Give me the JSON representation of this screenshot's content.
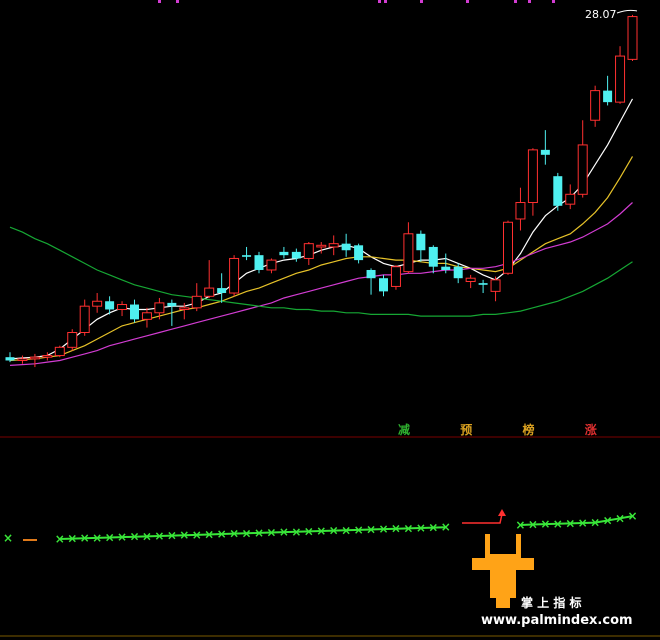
{
  "chart_data": {
    "type": "candlestick",
    "last_price_label": "28.07",
    "price_range": [
      0,
      30
    ],
    "candles": [
      {
        "o": 12.9,
        "h": 13.2,
        "l": 12.6,
        "c": 12.7,
        "up": false
      },
      {
        "o": 12.7,
        "h": 13.0,
        "l": 12.5,
        "c": 12.8,
        "up": true
      },
      {
        "o": 12.8,
        "h": 13.1,
        "l": 12.3,
        "c": 12.9,
        "up": true
      },
      {
        "o": 12.9,
        "h": 13.2,
        "l": 12.7,
        "c": 13.0,
        "up": true
      },
      {
        "o": 13.0,
        "h": 13.6,
        "l": 12.9,
        "c": 13.5,
        "up": true
      },
      {
        "o": 13.5,
        "h": 14.6,
        "l": 13.3,
        "c": 14.4,
        "up": true
      },
      {
        "o": 14.4,
        "h": 16.4,
        "l": 14.2,
        "c": 16.0,
        "up": true
      },
      {
        "o": 16.0,
        "h": 16.8,
        "l": 15.6,
        "c": 16.3,
        "up": true
      },
      {
        "o": 16.3,
        "h": 16.6,
        "l": 15.5,
        "c": 15.8,
        "up": false
      },
      {
        "o": 15.8,
        "h": 16.3,
        "l": 15.4,
        "c": 16.1,
        "up": true
      },
      {
        "o": 16.1,
        "h": 16.4,
        "l": 15.0,
        "c": 15.2,
        "up": false
      },
      {
        "o": 15.2,
        "h": 15.9,
        "l": 14.7,
        "c": 15.6,
        "up": true
      },
      {
        "o": 15.6,
        "h": 16.5,
        "l": 15.2,
        "c": 16.2,
        "up": true
      },
      {
        "o": 16.2,
        "h": 16.4,
        "l": 14.8,
        "c": 16.0,
        "up": false
      },
      {
        "o": 15.8,
        "h": 16.2,
        "l": 15.2,
        "c": 15.9,
        "up": true
      },
      {
        "o": 15.9,
        "h": 17.4,
        "l": 15.7,
        "c": 16.6,
        "up": true
      },
      {
        "o": 16.6,
        "h": 18.8,
        "l": 16.5,
        "c": 17.1,
        "up": true
      },
      {
        "o": 17.1,
        "h": 18.0,
        "l": 16.2,
        "c": 16.8,
        "up": false
      },
      {
        "o": 16.8,
        "h": 19.1,
        "l": 16.6,
        "c": 18.9,
        "up": true
      },
      {
        "o": 19.0,
        "h": 19.6,
        "l": 18.8,
        "c": 19.1,
        "up": false
      },
      {
        "o": 19.1,
        "h": 19.3,
        "l": 18.0,
        "c": 18.2,
        "up": false
      },
      {
        "o": 18.2,
        "h": 18.9,
        "l": 18.0,
        "c": 18.8,
        "up": true
      },
      {
        "o": 19.1,
        "h": 19.6,
        "l": 18.9,
        "c": 19.3,
        "up": false
      },
      {
        "o": 19.3,
        "h": 19.5,
        "l": 18.7,
        "c": 18.9,
        "up": false
      },
      {
        "o": 18.9,
        "h": 19.9,
        "l": 18.5,
        "c": 19.8,
        "up": true
      },
      {
        "o": 19.6,
        "h": 19.9,
        "l": 19.2,
        "c": 19.7,
        "up": true
      },
      {
        "o": 19.6,
        "h": 20.3,
        "l": 19.1,
        "c": 19.8,
        "up": true
      },
      {
        "o": 19.8,
        "h": 20.4,
        "l": 19.0,
        "c": 19.4,
        "up": false
      },
      {
        "o": 19.7,
        "h": 19.8,
        "l": 18.6,
        "c": 18.8,
        "up": false
      },
      {
        "o": 18.2,
        "h": 18.3,
        "l": 16.7,
        "c": 17.7,
        "up": false
      },
      {
        "o": 17.7,
        "h": 17.9,
        "l": 16.6,
        "c": 16.9,
        "up": false
      },
      {
        "o": 17.2,
        "h": 18.5,
        "l": 17.0,
        "c": 18.4,
        "up": true
      },
      {
        "o": 18.1,
        "h": 21.1,
        "l": 18.0,
        "c": 20.4,
        "up": true
      },
      {
        "o": 20.4,
        "h": 20.6,
        "l": 18.7,
        "c": 19.4,
        "up": false
      },
      {
        "o": 19.6,
        "h": 19.7,
        "l": 18.0,
        "c": 18.4,
        "up": false
      },
      {
        "o": 18.2,
        "h": 19.2,
        "l": 18.0,
        "c": 18.4,
        "up": false
      },
      {
        "o": 18.4,
        "h": 18.6,
        "l": 17.4,
        "c": 17.7,
        "up": false
      },
      {
        "o": 17.5,
        "h": 17.9,
        "l": 17.1,
        "c": 17.7,
        "up": true
      },
      {
        "o": 17.4,
        "h": 17.6,
        "l": 16.8,
        "c": 17.3,
        "up": false
      },
      {
        "o": 16.9,
        "h": 17.8,
        "l": 16.3,
        "c": 17.6,
        "up": true
      },
      {
        "o": 18.0,
        "h": 21.2,
        "l": 17.9,
        "c": 21.1,
        "up": true
      },
      {
        "o": 21.3,
        "h": 23.2,
        "l": 20.6,
        "c": 22.3,
        "up": true
      },
      {
        "o": 22.3,
        "h": 25.6,
        "l": 21.5,
        "c": 25.5,
        "up": true
      },
      {
        "o": 25.5,
        "h": 26.7,
        "l": 24.6,
        "c": 25.2,
        "up": false
      },
      {
        "o": 23.9,
        "h": 24.1,
        "l": 21.8,
        "c": 22.1,
        "up": false
      },
      {
        "o": 22.2,
        "h": 23.4,
        "l": 21.9,
        "c": 22.8,
        "up": true
      },
      {
        "o": 22.8,
        "h": 27.3,
        "l": 22.6,
        "c": 25.8,
        "up": true
      },
      {
        "o": 27.3,
        "h": 29.4,
        "l": 26.9,
        "c": 29.1,
        "up": true
      },
      {
        "o": 29.1,
        "h": 30.0,
        "l": 28.2,
        "c": 28.4,
        "up": false
      },
      {
        "o": 28.4,
        "h": 31.8,
        "l": 28.3,
        "c": 31.2,
        "up": true
      },
      {
        "o": 31.0,
        "h": 33.7,
        "l": 30.9,
        "c": 33.6,
        "up": true
      }
    ],
    "ma_series": [
      {
        "color": "#ffffff",
        "values": [
          12.8,
          12.85,
          12.9,
          13.0,
          13.4,
          14.0,
          14.6,
          15.2,
          15.6,
          15.9,
          15.8,
          15.8,
          15.9,
          16.0,
          16.0,
          16.2,
          16.6,
          16.8,
          17.4,
          18.0,
          18.3,
          18.6,
          18.8,
          18.9,
          19.1,
          19.4,
          19.6,
          19.7,
          19.5,
          19.0,
          18.6,
          18.4,
          18.6,
          18.8,
          18.8,
          18.9,
          18.6,
          18.3,
          17.9,
          17.6,
          18.2,
          19.2,
          20.5,
          21.5,
          22.1,
          22.6,
          23.4,
          24.6,
          25.8,
          27.2,
          28.6
        ]
      },
      {
        "color": "#e6c229",
        "values": [
          12.7,
          12.75,
          12.8,
          12.9,
          13.0,
          13.3,
          13.6,
          14.0,
          14.4,
          14.8,
          15.0,
          15.2,
          15.4,
          15.6,
          15.8,
          15.9,
          16.1,
          16.3,
          16.6,
          16.9,
          17.1,
          17.4,
          17.7,
          18.0,
          18.2,
          18.5,
          18.7,
          18.9,
          19.0,
          19.0,
          18.9,
          18.8,
          18.8,
          18.7,
          18.6,
          18.6,
          18.4,
          18.3,
          18.2,
          18.1,
          18.3,
          18.8,
          19.3,
          19.8,
          20.1,
          20.4,
          21.0,
          21.7,
          22.6,
          23.8,
          25.1
        ]
      },
      {
        "color": "#d23cd2",
        "values": [
          12.4,
          12.45,
          12.5,
          12.6,
          12.7,
          12.9,
          13.1,
          13.3,
          13.6,
          13.8,
          14.0,
          14.2,
          14.4,
          14.6,
          14.8,
          15.0,
          15.2,
          15.4,
          15.6,
          15.8,
          16.0,
          16.2,
          16.5,
          16.7,
          16.9,
          17.1,
          17.3,
          17.5,
          17.7,
          17.8,
          17.9,
          17.9,
          18.0,
          18.0,
          18.1,
          18.2,
          18.2,
          18.3,
          18.3,
          18.4,
          18.6,
          18.9,
          19.2,
          19.5,
          19.7,
          19.9,
          20.2,
          20.6,
          21.0,
          21.6,
          22.3
        ]
      },
      {
        "color": "#16a734",
        "values": [
          20.8,
          20.5,
          20.1,
          19.8,
          19.4,
          19.0,
          18.6,
          18.2,
          17.9,
          17.6,
          17.3,
          17.1,
          16.9,
          16.7,
          16.6,
          16.5,
          16.4,
          16.3,
          16.2,
          16.1,
          16.0,
          15.9,
          15.9,
          15.8,
          15.8,
          15.7,
          15.7,
          15.6,
          15.6,
          15.5,
          15.5,
          15.5,
          15.5,
          15.4,
          15.4,
          15.4,
          15.4,
          15.4,
          15.5,
          15.5,
          15.6,
          15.7,
          15.9,
          16.1,
          16.3,
          16.6,
          16.9,
          17.3,
          17.7,
          18.2,
          18.7
        ]
      }
    ],
    "signal_labels": [
      {
        "text": "减",
        "index": 31,
        "color": "#2fb02f"
      },
      {
        "text": "预",
        "index": 36,
        "color": "#d9a020"
      },
      {
        "text": "榜",
        "index": 41,
        "color": "#d9a020"
      },
      {
        "text": "涨",
        "index": 46,
        "color": "#e03030"
      }
    ],
    "indicator": {
      "marker": "×",
      "marker_color": "#39e639",
      "line_color": "#39e639",
      "gap_line_color": "#ff3030",
      "orange_dash_color": "#e07a1a"
    },
    "watermark": {
      "brand_text": "掌 上 指 标",
      "url_text": "www.palmindex.com"
    },
    "colors": {
      "up": "#ff3030",
      "down": "#4ff0f0",
      "background": "#000000",
      "separator": "#7a0000"
    }
  }
}
